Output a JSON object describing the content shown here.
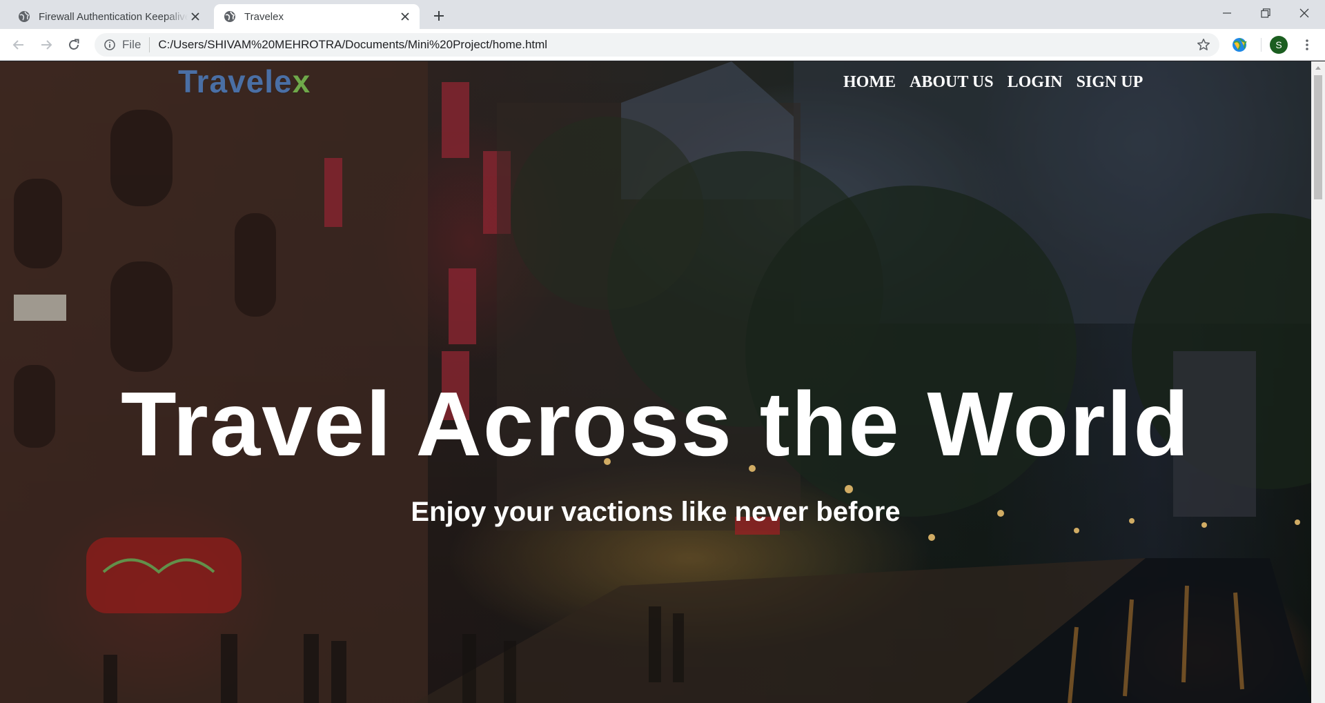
{
  "browser": {
    "tabs": [
      {
        "title": "Firewall Authentication Keepalive Window",
        "active": false,
        "icon": "globe-icon"
      },
      {
        "title": "Travelex",
        "active": true,
        "icon": "globe-icon"
      }
    ],
    "address": {
      "scheme_label": "File",
      "url": "C:/Users/SHIVAM%20MEHROTRA/Documents/Mini%20Project/home.html"
    },
    "profile_initial": "S",
    "profile_color": "#1b5e20"
  },
  "page": {
    "logo": {
      "main": "Travele",
      "accent": "x",
      "main_color": "#4a6fa5",
      "accent_color": "#6fa84a"
    },
    "nav": [
      {
        "label": "HOME"
      },
      {
        "label": "ABOUT US"
      },
      {
        "label": "LOGIN"
      },
      {
        "label": "SIGN UP"
      }
    ],
    "hero": {
      "title": "Travel Across the World",
      "subtitle": "Enjoy your vactions like never before"
    }
  }
}
